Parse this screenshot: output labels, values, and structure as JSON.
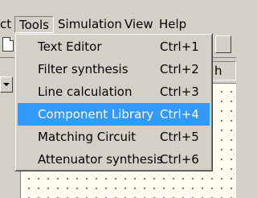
{
  "menubar": {
    "items": [
      {
        "label": "ct"
      },
      {
        "label": "Tools"
      },
      {
        "label": "Simulation"
      },
      {
        "label": "View"
      },
      {
        "label": "Help"
      }
    ],
    "open_menu": "Tools"
  },
  "toolbar": {
    "field_text": "h"
  },
  "tools_menu": {
    "items": [
      {
        "label": "Text Editor",
        "shortcut": "Ctrl+1",
        "selected": false
      },
      {
        "label": "Filter synthesis",
        "shortcut": "Ctrl+2",
        "selected": false
      },
      {
        "label": "Line calculation",
        "shortcut": "Ctrl+3",
        "selected": false
      },
      {
        "label": "Component Library",
        "shortcut": "Ctrl+4",
        "selected": true
      },
      {
        "label": "Matching Circuit",
        "shortcut": "Ctrl+5",
        "selected": false
      },
      {
        "label": "Attenuator synthesis",
        "shortcut": "Ctrl+6",
        "selected": false
      }
    ]
  },
  "colors": {
    "chrome": "#d4d0c8",
    "highlight": "#3399ff",
    "canvas": "#fffdf0"
  }
}
